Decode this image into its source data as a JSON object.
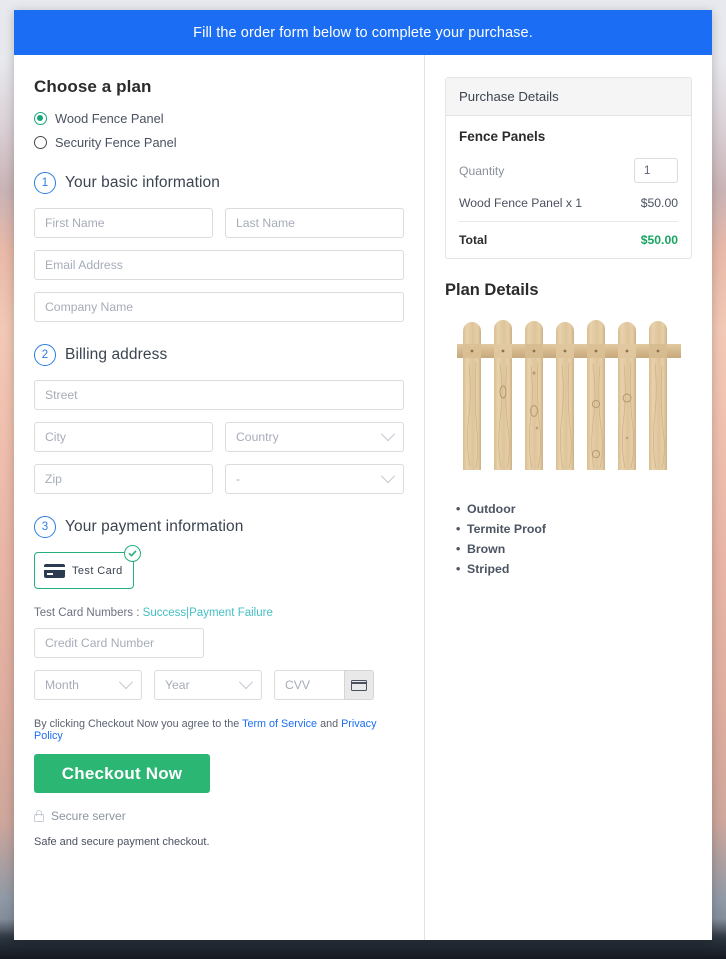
{
  "banner": {
    "message": "Fill the order form below to complete your purchase."
  },
  "plan_chooser": {
    "title": "Choose a plan",
    "options": [
      {
        "label": "Wood Fence Panel",
        "selected": true
      },
      {
        "label": "Security Fence Panel",
        "selected": false
      }
    ]
  },
  "steps": [
    {
      "number": "1",
      "label": "Your basic information"
    },
    {
      "number": "2",
      "label": "Billing address"
    },
    {
      "number": "3",
      "label": "Your payment information"
    }
  ],
  "basic_info": {
    "first_name_placeholder": "First Name",
    "last_name_placeholder": "Last Name",
    "email_placeholder": "Email Address",
    "company_placeholder": "Company Name"
  },
  "billing": {
    "street_placeholder": "Street",
    "city_placeholder": "City",
    "country_placeholder": "Country",
    "zip_placeholder": "Zip",
    "state_placeholder": "-"
  },
  "payment": {
    "method_label": "Test Card",
    "test_numbers_prefix": "Test Card Numbers :",
    "success_link": "Success",
    "separator": "|",
    "failure_link": "Payment Failure",
    "card_number_placeholder": "Credit Card Number",
    "month_placeholder": "Month",
    "year_placeholder": "Year",
    "cvv_placeholder": "CVV"
  },
  "footer": {
    "terms_prefix": "By clicking Checkout Now you agree to the",
    "terms_link": "Term of Service",
    "terms_and": "and",
    "privacy_link": "Privacy Policy",
    "checkout_label": "Checkout Now",
    "secure_server": "Secure server",
    "safe_note": "Safe and secure payment checkout."
  },
  "purchase_details": {
    "header": "Purchase Details",
    "product_name": "Fence Panels",
    "quantity_label": "Quantity",
    "quantity_value": "1",
    "line_item_label": "Wood Fence Panel x 1",
    "line_item_price": "$50.00",
    "total_label": "Total",
    "total_price": "$50.00"
  },
  "plan_details": {
    "title": "Plan Details",
    "image_alt": "wood-fence-panel-photo",
    "features": [
      "Outdoor",
      "Termite Proof",
      "Brown",
      "Striped"
    ]
  },
  "colors": {
    "banner_blue": "#1b6ef3",
    "checkout_green": "#2bb673",
    "total_green": "#19a463",
    "selected_radio_green": "#1aa67a",
    "step_blue": "#2a7de1",
    "link_teal": "#45bfc4",
    "link_blue": "#1b6ef3"
  }
}
